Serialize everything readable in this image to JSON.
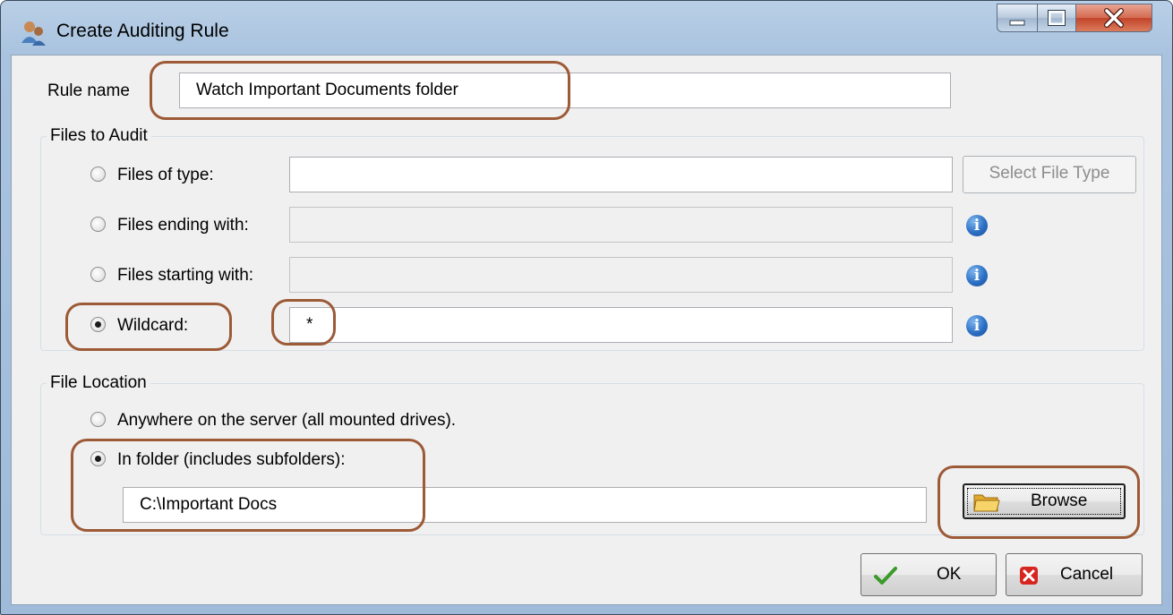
{
  "window": {
    "title": "Create Auditing Rule"
  },
  "rule": {
    "name_label": "Rule name",
    "name_value": "Watch Important Documents folder"
  },
  "files_to_audit": {
    "group_title": "Files to Audit",
    "options": [
      {
        "label": "Files of type:",
        "checked": false,
        "value": ""
      },
      {
        "label": "Files ending with:",
        "checked": false,
        "value": ""
      },
      {
        "label": "Files starting with:",
        "checked": false,
        "value": ""
      },
      {
        "label": "Wildcard:",
        "checked": true,
        "value": "*"
      }
    ],
    "select_file_type_label": "Select File Type",
    "info_glyph": "i"
  },
  "file_location": {
    "group_title": "File Location",
    "anywhere_label": "Anywhere on the server (all mounted drives).",
    "anywhere_checked": false,
    "in_folder_label": "In folder (includes subfolders):",
    "in_folder_checked": true,
    "folder_path": "C:\\Important Docs",
    "browse_label": "Browse"
  },
  "buttons": {
    "ok_label": "OK",
    "cancel_label": "Cancel"
  },
  "icons": {
    "window": "users-icon",
    "info": "info-icon",
    "browse": "folder-icon",
    "ok": "checkmark-icon",
    "cancel": "red-x-icon"
  },
  "colors": {
    "annotation": "#9c5a37",
    "info_blue": "#2b6fc4",
    "ok_green": "#3a9a2a",
    "cancel_red": "#d7251f"
  }
}
